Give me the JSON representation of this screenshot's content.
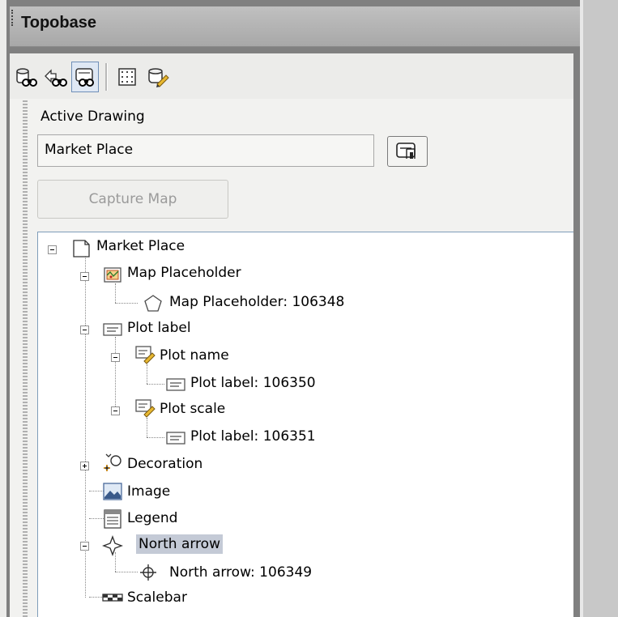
{
  "panel": {
    "title": "Topobase"
  },
  "toolbar": {
    "buttons": [
      {
        "icon": "search-data-icon"
      },
      {
        "icon": "dataset-search-icon"
      },
      {
        "icon": "map-search-icon",
        "active": true
      },
      {
        "icon": "grid-layout-icon"
      },
      {
        "icon": "edit-database-icon"
      }
    ]
  },
  "active_drawing": {
    "label": "Active Drawing",
    "value": "Market Place"
  },
  "capture_button": {
    "label": "Capture Map",
    "enabled": false
  },
  "tree": {
    "nodes": [
      {
        "label": "Market Place",
        "icon": "document-icon",
        "expanded": true
      },
      {
        "label": "Map Placeholder",
        "icon": "map-placeholder-icon",
        "expanded": true
      },
      {
        "label": "Map Placeholder: 106348",
        "icon": "pentagon-icon"
      },
      {
        "label": "Plot label",
        "icon": "label-icon",
        "expanded": true
      },
      {
        "label": "Plot name",
        "icon": "label-edit-icon",
        "expanded": true
      },
      {
        "label": "Plot label: 106350",
        "icon": "label-icon"
      },
      {
        "label": "Plot scale",
        "icon": "label-edit-icon",
        "expanded": true
      },
      {
        "label": "Plot label: 106351",
        "icon": "label-icon"
      },
      {
        "label": "Decoration",
        "icon": "decoration-icon",
        "expanded": false
      },
      {
        "label": "Image",
        "icon": "image-icon"
      },
      {
        "label": "Legend",
        "icon": "legend-icon"
      },
      {
        "label": "North arrow",
        "icon": "north-arrow-icon",
        "expanded": true,
        "selected": true
      },
      {
        "label": "North arrow: 106349",
        "icon": "crosshair-icon"
      },
      {
        "label": "Scalebar",
        "icon": "scalebar-icon"
      }
    ]
  }
}
